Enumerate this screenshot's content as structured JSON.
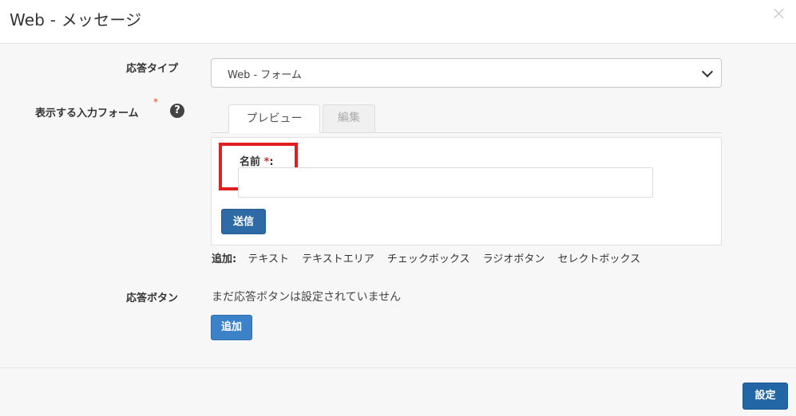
{
  "dialog": {
    "title": "Web - メッセージ"
  },
  "response_type": {
    "label": "応答タイプ",
    "selected": "Web - フォーム"
  },
  "input_form": {
    "label": "表示する入力フォーム",
    "required_mark": "*",
    "help_glyph": "?",
    "tabs": [
      {
        "label": "プレビュー",
        "active": true
      },
      {
        "label": "編集",
        "active": false
      }
    ],
    "field": {
      "label": "名前",
      "required_mark": "*",
      "suffix": ":",
      "value": "",
      "placeholder": ""
    },
    "submit_label": "送信",
    "add_row": {
      "label": "追加:",
      "items": [
        "テキスト",
        "テキストエリア",
        "チェックボックス",
        "ラジオボタン",
        "セレクトボックス"
      ]
    }
  },
  "response_button": {
    "label": "応答ボタン",
    "empty_text": "まだ応答ボタンは設定されていません",
    "add_label": "追加"
  },
  "footer": {
    "confirm_label": "設定"
  },
  "colors": {
    "primary_button": "#2e6aa6",
    "highlight_box": "#e02020",
    "required": "#d32f2f"
  }
}
